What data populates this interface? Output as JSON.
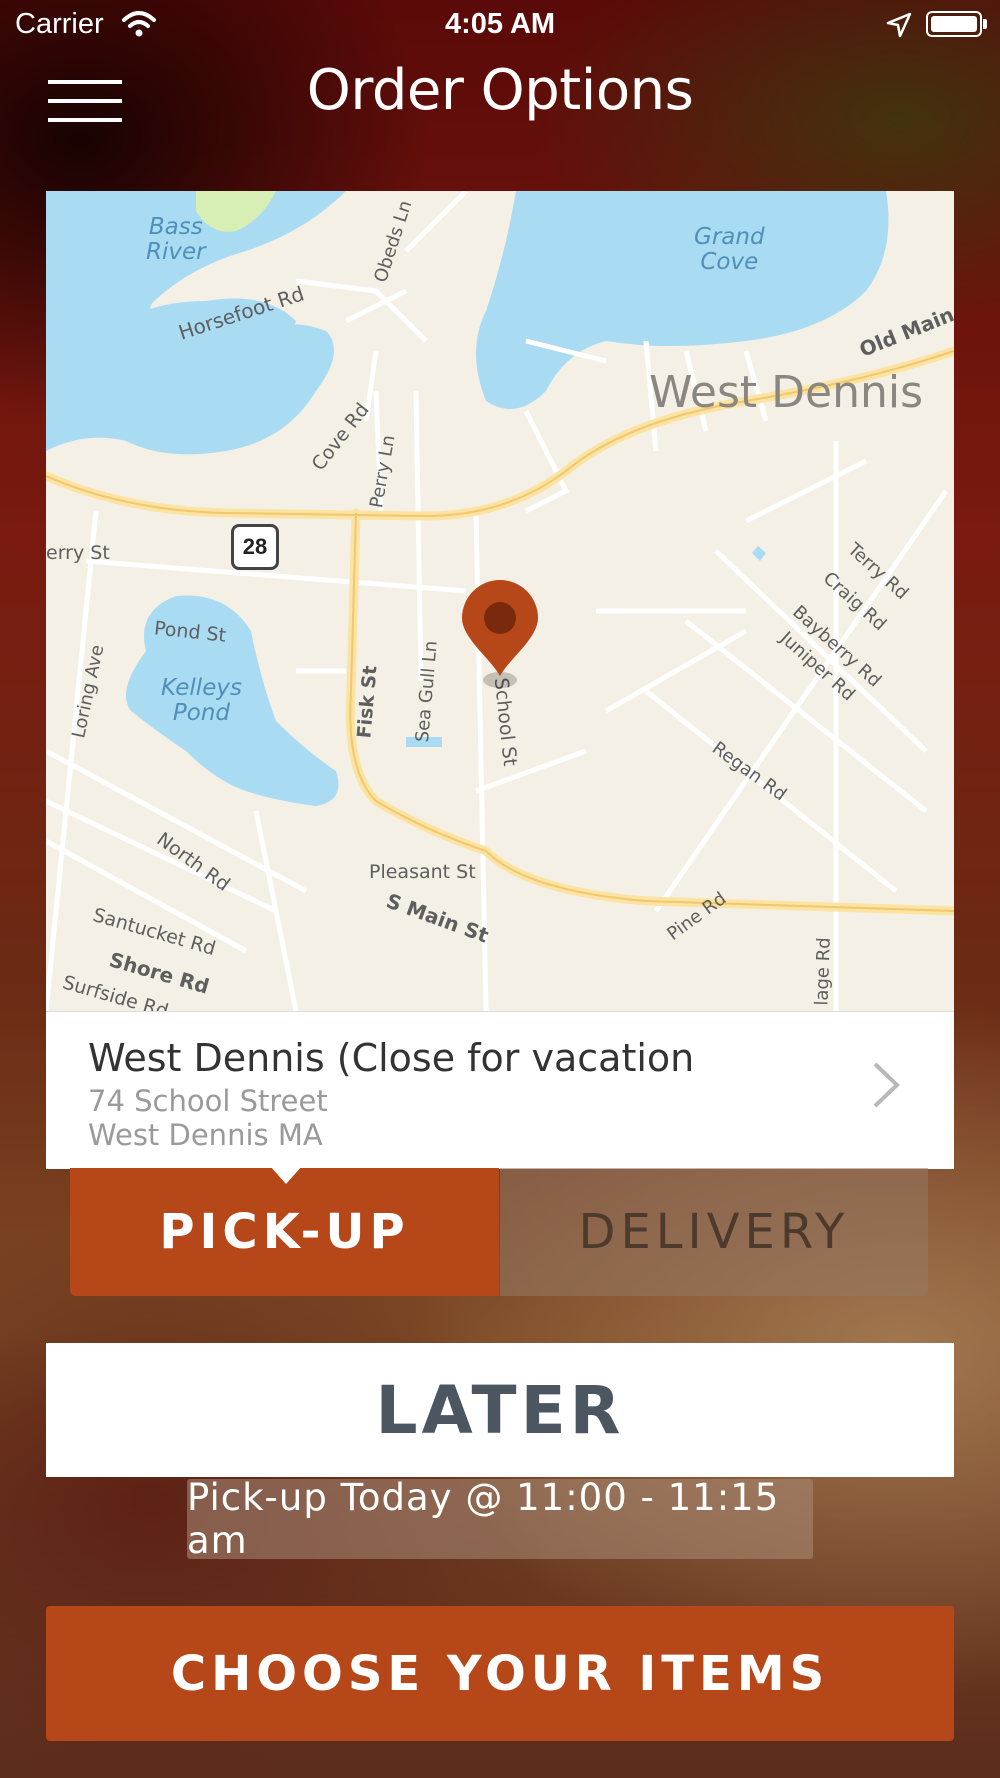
{
  "status_bar": {
    "carrier": "Carrier",
    "time": "4:05 AM",
    "icons": [
      "wifi-icon",
      "location-arrow-icon",
      "battery-icon"
    ]
  },
  "header": {
    "menu_icon": "hamburger-menu-icon",
    "title": "Order Options"
  },
  "map": {
    "town_label": "West Dennis",
    "water_labels": [
      {
        "name": "Bass River",
        "lines": [
          "Bass",
          "River"
        ]
      },
      {
        "name": "Grand Cove",
        "lines": [
          "Grand",
          "Cove"
        ]
      },
      {
        "name": "Kelleys Pond",
        "lines": [
          "Kelleys",
          "Pond"
        ]
      }
    ],
    "route_number": "28",
    "street_labels": [
      "Horsefoot Rd",
      "Obeds Ln",
      "Cove Rd",
      "Perry Ln",
      "Old Main S",
      "erry St",
      "Pond St",
      "Loring Ave",
      "Fisk St",
      "Sea Gull Ln",
      "School St",
      "Terry Rd",
      "Craig Rd",
      "Bayberry Rd",
      "Juniper Rd",
      "Regan Rd",
      "North Rd",
      "Pleasant St",
      "S Main St",
      "Santucket Rd",
      "Shore Rd",
      "Surfside Rd",
      "Pine Rd",
      "lage Rd"
    ],
    "pin_icon": "map-pin-icon",
    "colors": {
      "land": "#f5f0e6",
      "water": "#a9dcf3",
      "road": "#fbe3a2",
      "pin": "#b64719"
    }
  },
  "location": {
    "name": "West Dennis (Close for vacation",
    "address_line1": "74 School Street",
    "address_line2": "West Dennis MA",
    "chevron_icon": "chevron-right-icon"
  },
  "order_mode": {
    "pickup_label": "PICK-UP",
    "delivery_label": "DELIVERY",
    "selected": "PICK-UP"
  },
  "timing": {
    "later_label": "LATER",
    "pickup_time": "Pick-up Today @ 11:00 - 11:15 am"
  },
  "cta": {
    "label": "CHOOSE YOUR ITEMS"
  },
  "colors": {
    "accent": "#b64719",
    "later_text": "#4b5661"
  }
}
